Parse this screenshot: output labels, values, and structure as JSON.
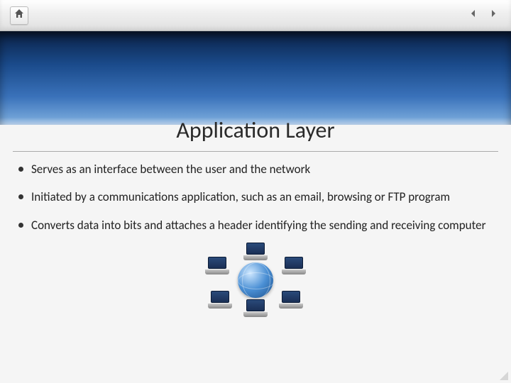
{
  "slide": {
    "title": "Application Layer",
    "bullets": [
      "Serves as an interface between the user and the network",
      "Initiated by a communications application, such as an email, browsing or FTP program",
      "Converts data into bits and attaches a header identifying the sending and receiving computer"
    ]
  }
}
